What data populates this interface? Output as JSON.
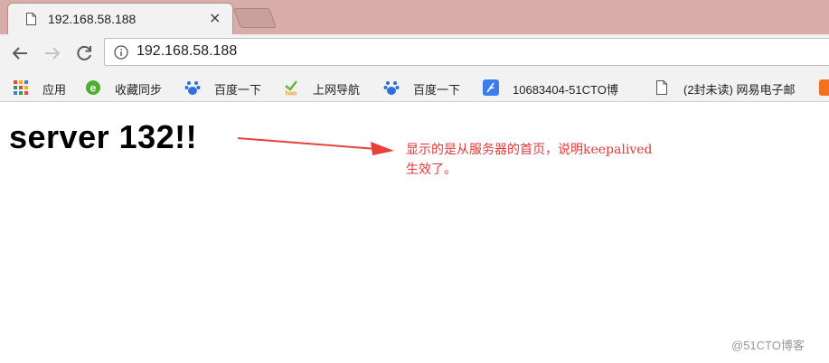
{
  "tab": {
    "title": "192.168.58.188",
    "close": "×"
  },
  "address_bar": {
    "url": "192.168.58.188"
  },
  "bookmarks": [
    {
      "label": "应用",
      "icon": "apps-grid-icon"
    },
    {
      "label": "收藏同步",
      "icon": "sync-e-icon"
    },
    {
      "label": "百度一下",
      "icon": "baidu-paw-icon"
    },
    {
      "label": "上网导航",
      "icon": "hao-icon"
    },
    {
      "label": "百度一下",
      "icon": "baidu-paw-icon"
    },
    {
      "label": "10683404-51CTO博",
      "icon": "feather-icon"
    },
    {
      "label": "(2封未读) 网易电子邮",
      "icon": "page-icon"
    }
  ],
  "page": {
    "heading": "server 132!!"
  },
  "annotation": {
    "line1": "显示的是从服务器的首页，说明keepalived",
    "line2": "生效了。"
  },
  "watermark": "@51CTO博客",
  "colors": {
    "tabstrip": "#d8aca8",
    "annotation": "#e23a3a",
    "arrow": "#e8403a"
  }
}
